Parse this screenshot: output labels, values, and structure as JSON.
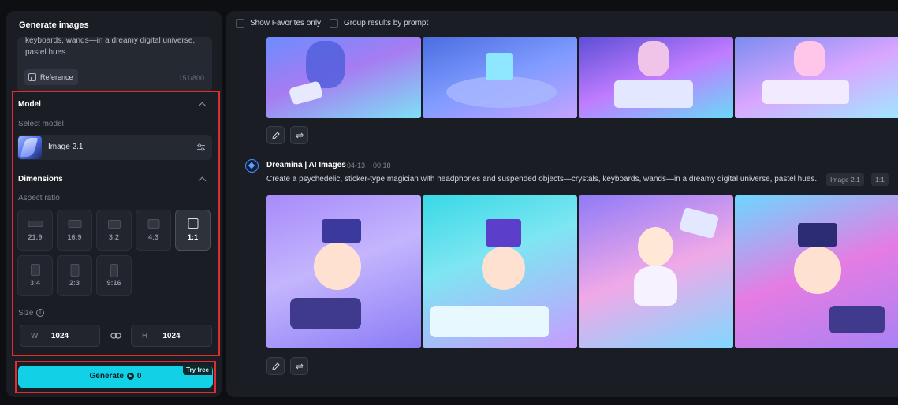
{
  "left_panel": {
    "title": "Generate images",
    "prompt_visible": "keyboards, wands—in a dreamy digital universe, pastel hues.",
    "reference_label": "Reference",
    "char_count": "151/800",
    "model_section": "Model",
    "select_model_label": "Select model",
    "model_name": "Image 2.1",
    "dimensions_section": "Dimensions",
    "aspect_ratio_label": "Aspect ratio",
    "aspect_ratios": [
      "21:9",
      "16:9",
      "3:2",
      "4:3",
      "1:1",
      "3:4",
      "2:3",
      "9:16"
    ],
    "selected_ratio": "1:1",
    "size_label": "Size",
    "width_label": "W",
    "width_value": "1024",
    "height_label": "H",
    "height_value": "1024",
    "generate_label": "Generate",
    "generate_cost": "0",
    "try_free": "Try free"
  },
  "right_panel": {
    "show_favorites": "Show Favorites only",
    "group_by_prompt": "Group results by prompt",
    "result_author": "Dreamina | AI Images",
    "result_date": "04-13",
    "result_time": "00:18",
    "result_prompt": "Create a psychedelic, sticker-type magician with headphones and suspended objects—crystals, keyboards, wands—in a dreamy digital universe, pastel hues.",
    "tag_model": "Image 2.1",
    "tag_ratio": "1:1"
  },
  "icons": [
    "reference-icon",
    "chevron-up-icon",
    "settings-sliders-icon",
    "info-icon",
    "link-icon",
    "credit-icon",
    "edit-icon",
    "regenerate-icon",
    "dreamina-avatar-icon"
  ],
  "colors": {
    "accent": "#12d0e6",
    "highlight_frame": "#e02d2d",
    "panel_bg": "#1a1d24",
    "page_bg": "#0d0f13"
  }
}
